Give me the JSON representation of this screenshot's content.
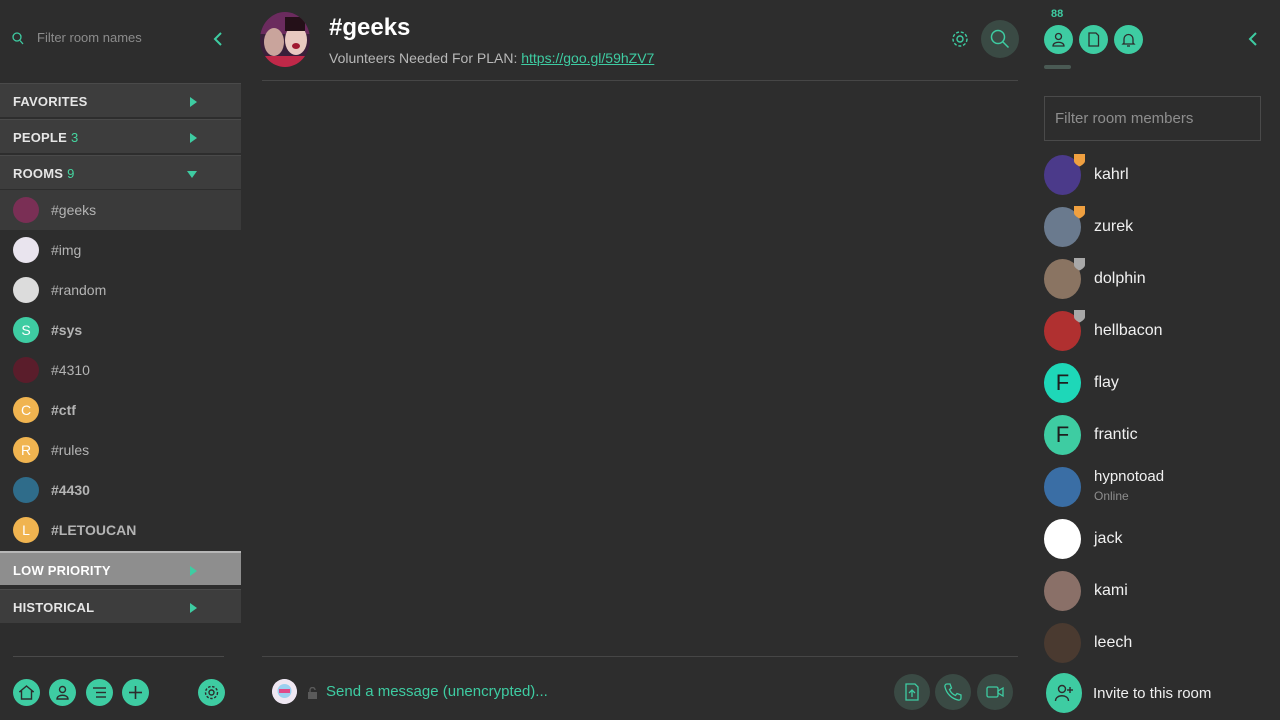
{
  "colors": {
    "accent": "#3ecca2",
    "background": "#2d2d2d",
    "section_header": "#3d3d3d"
  },
  "left": {
    "filter_placeholder": "Filter room names",
    "sections": {
      "favorites": {
        "label": "FAVORITES",
        "count": ""
      },
      "people": {
        "label": "PEOPLE",
        "count": "3"
      },
      "rooms": {
        "label": "ROOMS",
        "count": "9"
      },
      "low_priority": {
        "label": "LOW PRIORITY",
        "count": ""
      },
      "historical": {
        "label": "HISTORICAL",
        "count": ""
      }
    },
    "rooms": [
      {
        "name": "#geeks",
        "initial": "",
        "bold": false,
        "active": true,
        "avatar_color": "#7a2f55"
      },
      {
        "name": "#img",
        "initial": "",
        "bold": false,
        "active": false,
        "avatar_color": "#e9e4ee"
      },
      {
        "name": "#random",
        "initial": "",
        "bold": false,
        "active": false,
        "avatar_color": "#dcdcdc"
      },
      {
        "name": "#sys",
        "initial": "S",
        "bold": true,
        "active": false,
        "avatar_color": "#3ecca2"
      },
      {
        "name": "#4310",
        "initial": "",
        "bold": false,
        "active": false,
        "avatar_color": "#5a1d2b"
      },
      {
        "name": "#ctf",
        "initial": "C",
        "bold": true,
        "active": false,
        "avatar_color": "#f0b450"
      },
      {
        "name": "#rules",
        "initial": "R",
        "bold": false,
        "active": false,
        "avatar_color": "#f0b450"
      },
      {
        "name": "#4430",
        "initial": "",
        "bold": true,
        "active": false,
        "avatar_color": "#2f6c8a"
      },
      {
        "name": "#LETOUCAN",
        "initial": "L",
        "bold": true,
        "active": false,
        "avatar_color": "#f0b450"
      }
    ],
    "bottom_buttons": [
      "home-icon",
      "people-icon",
      "room-directory-icon",
      "create-room-icon",
      "settings-icon"
    ]
  },
  "center": {
    "room_title": "#geeks",
    "topic_text": "Volunteers Needed For PLAN: ",
    "topic_link": "https://goo.gl/59hZV7",
    "composer_placeholder": "Send a message (unencrypted)..."
  },
  "right": {
    "member_count": "88",
    "filter_placeholder": "Filter room members",
    "members": [
      {
        "name": "kahrl",
        "initial": "",
        "status": "",
        "badge": "admin",
        "avatar_color": "#4b3a8a"
      },
      {
        "name": "zurek",
        "initial": "",
        "status": "",
        "badge": "admin",
        "avatar_color": "#6a7a8e"
      },
      {
        "name": "dolphin",
        "initial": "",
        "status": "",
        "badge": "mod",
        "avatar_color": "#8a7462"
      },
      {
        "name": "hellbacon",
        "initial": "",
        "status": "",
        "badge": "mod",
        "avatar_color": "#b03030"
      },
      {
        "name": "flay",
        "initial": "F",
        "status": "",
        "badge": "",
        "avatar_color": "#1ed7b8"
      },
      {
        "name": "frantic",
        "initial": "F",
        "status": "",
        "badge": "",
        "avatar_color": "#3ecca2"
      },
      {
        "name": "hypnotoad",
        "initial": "",
        "status": "Online",
        "badge": "",
        "avatar_color": "#3a6ea5"
      },
      {
        "name": "jack",
        "initial": "",
        "status": "",
        "badge": "",
        "avatar_color": "#ffffff"
      },
      {
        "name": "kami",
        "initial": "",
        "status": "",
        "badge": "",
        "avatar_color": "#8a7068"
      },
      {
        "name": "leech",
        "initial": "",
        "status": "",
        "badge": "",
        "avatar_color": "#4a3a30"
      }
    ],
    "invite_label": "Invite to this room"
  }
}
